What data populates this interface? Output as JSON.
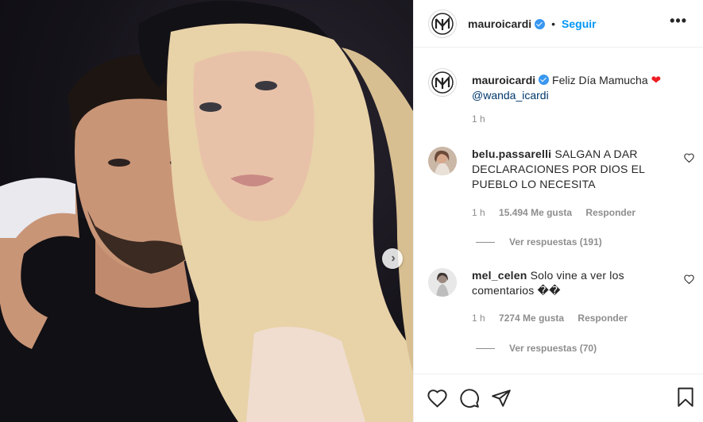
{
  "header": {
    "username": "mauroicardi",
    "separator": "•",
    "follow_label": "Seguir",
    "more_label": "•••"
  },
  "caption": {
    "username": "mauroicardi",
    "text": "Feliz Día Mamucha",
    "emoji": "❤",
    "mention": "@wanda_icardi",
    "time": "1 h"
  },
  "comments": [
    {
      "username": "belu.passarelli",
      "text": "SALGAN A DAR DECLARACIONES POR DIOS EL PUEBLO LO NECESITA",
      "time": "1 h",
      "likes": "15.494 Me gusta",
      "reply": "Responder",
      "view_replies": "Ver respuestas (191)"
    },
    {
      "username": "mel_celen",
      "text": "Solo vine a ver los comentarios ��",
      "time": "1 h",
      "likes": "7274 Me gusta",
      "reply": "Responder",
      "view_replies": "Ver respuestas (70)"
    }
  ],
  "icons": {
    "like": "heart-outline-icon",
    "comment": "comment-bubble-icon",
    "share": "paper-plane-icon",
    "save": "bookmark-icon",
    "verified": "verified-badge-icon",
    "next": "chevron-right-icon"
  },
  "colors": {
    "accent": "#0095f6",
    "verified": "#3897f0",
    "muted": "#8e8e8e",
    "text": "#262626",
    "heart": "#ed1c24"
  }
}
